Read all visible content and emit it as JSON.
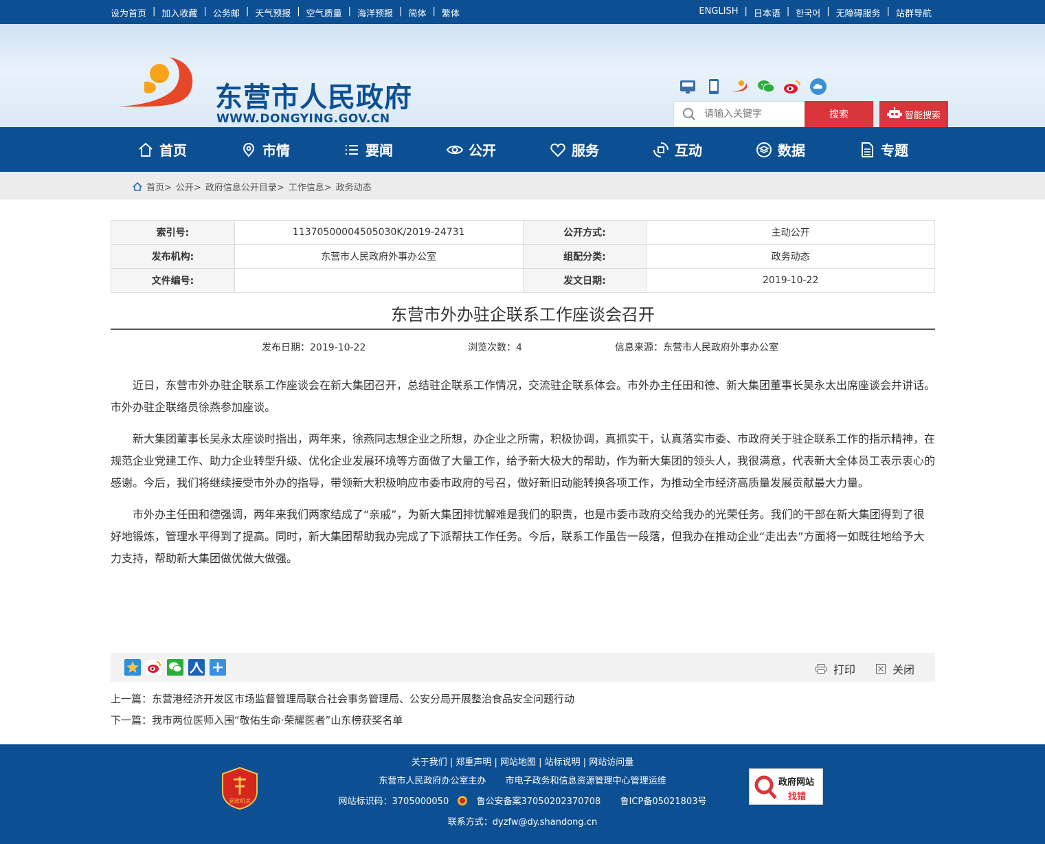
{
  "topbar": {
    "left": [
      "设为首页",
      "加入收藏",
      "公务邮",
      "天气预报",
      "空气质量",
      "海洋预报",
      "简体",
      "繁体"
    ],
    "right": [
      "ENGLISH",
      "日本语",
      "한국어",
      "无障碍服务",
      "站群导航"
    ]
  },
  "header": {
    "title": "东营市人民政府",
    "url": "WWW.DONGYING.GOV.CN",
    "search_placeholder": "请输入关键字",
    "search_button": "搜索",
    "smart_search": "智能搜索"
  },
  "nav": [
    "首页",
    "市情",
    "要闻",
    "公开",
    "服务",
    "互动",
    "数据",
    "专题"
  ],
  "breadcrumb": [
    "首页>",
    "公开>",
    "政府信息公开目录>",
    "工作信息>",
    "政务动态"
  ],
  "meta": {
    "index_label": "索引号:",
    "index_value": "11370500004505030K/2019-24731",
    "mode_label": "公开方式:",
    "mode_value": "主动公开",
    "org_label": "发布机构:",
    "org_value": "东营市人民政府外事办公室",
    "cat_label": "组配分类:",
    "cat_value": "政务动态",
    "doc_label": "文件编号:",
    "doc_value": "",
    "date_label": "发文日期:",
    "date_value": "2019-10-22"
  },
  "article": {
    "title": "东营市外办驻企联系工作座谈会召开",
    "publish": "发布日期：2019-10-22",
    "views": "浏览次数：4",
    "source": "信息来源：东营市人民政府外事办公室",
    "paragraphs": [
      "近日，东营市外办驻企联系工作座谈会在新大集团召开，总结驻企联系工作情况，交流驻企联系体会。市外办主任田和德、新大集团董事长吴永太出席座谈会并讲话。市外办驻企联络员徐燕参加座谈。",
      "新大集团董事长吴永太座谈时指出，两年来，徐燕同志想企业之所想，办企业之所需，积极协调，真抓实干，认真落实市委、市政府关于驻企联系工作的指示精神，在规范企业党建工作、助力企业转型升级、优化企业发展环境等方面做了大量工作，给予新大极大的帮助，作为新大集团的领头人，我很满意，代表新大全体员工表示衷心的感谢。今后，我们将继续接受市外办的指导，带领新大积极响应市委市政府的号召，做好新旧动能转换各项工作，为推动全市经济高质量发展贡献最大力量。",
      "市外办主任田和德强调，两年来我们两家结成了“亲戚”，为新大集团排忧解难是我们的职责，也是市委市政府交给我办的光荣任务。我们的干部在新大集团得到了很好地锻炼，管理水平得到了提高。同时，新大集团帮助我办完成了下派帮扶工作任务。今后，联系工作虽告一段落，但我办在推动企业“走出去”方面将一如既往地给予大力支持，帮助新大集团做优做大做强。"
    ]
  },
  "tools": {
    "print": "打印",
    "close": "关闭"
  },
  "prevnext": {
    "prev": "上一篇：东营港经济开发区市场监督管理局联合社会事务管理局、公安分局开展整治食品安全问题行动",
    "next": "下一篇：我市两位医师入围“敬佑生命·荣耀医者”山东榜获奖名单"
  },
  "footer": {
    "links": "关于我们 | 郑重声明 | 网站地图 | 站标说明 | 网站访问量",
    "host": "东营市人民政府办公室主办",
    "ops": "市电子政务和信息资源管理中心管理运维",
    "site_id": "网站标识码：3705000050",
    "police": "鲁公安备案37050202370708",
    "icp": "鲁ICP备05021803号",
    "contact": "联系方式：dyzfw@dy.shandong.cn",
    "badge_text": "党政机关",
    "error_line1": "政府网站",
    "error_line2": "找错"
  },
  "colors": {
    "brand": "#0d4f93",
    "accent": "#d9353b"
  }
}
